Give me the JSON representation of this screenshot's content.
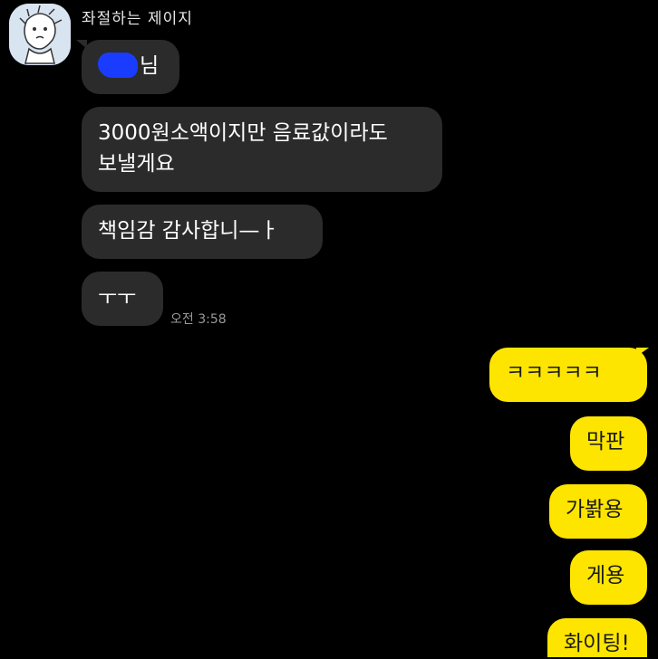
{
  "chat": {
    "sender_name": "좌절하는 제이지",
    "avatar_icon": "character-sketch-avatar",
    "incoming": [
      {
        "text": "님",
        "redacted_prefix": true
      },
      {
        "text": "3000원소액이지만 음료값이라도"
      },
      {
        "text": "보낼게요"
      },
      {
        "text": "책임감 감사합니—ㅏ"
      },
      {
        "text": "ㅜㅜ"
      }
    ],
    "incoming_time": "오전 3:58",
    "outgoing": [
      {
        "text": "ㅋㅋㅋㅋㅋ"
      },
      {
        "text": "막판"
      },
      {
        "text": "가봙용"
      },
      {
        "text": "게용"
      },
      {
        "text": "화이팅!"
      }
    ]
  },
  "colors": {
    "background": "#000000",
    "incoming_bubble": "#2b2b2b",
    "outgoing_bubble": "#fee500",
    "redaction": "#1a3cff"
  }
}
